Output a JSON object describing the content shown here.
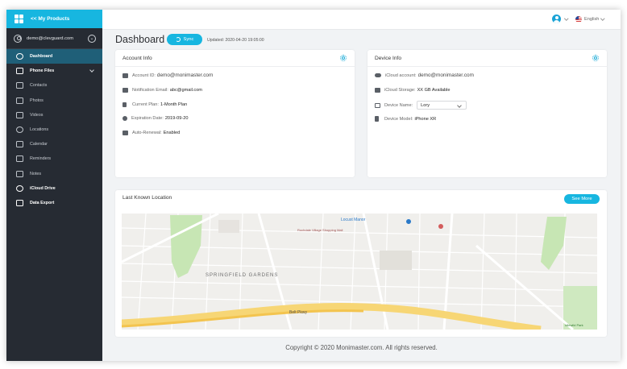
{
  "sidebar": {
    "back_label": "<< My Products",
    "account_email": "demo@clevguard.com",
    "items": [
      {
        "label": "Dashboard"
      },
      {
        "label": "Phone Files"
      },
      {
        "label": "Contacts"
      },
      {
        "label": "Photos"
      },
      {
        "label": "Videos"
      },
      {
        "label": "Locations"
      },
      {
        "label": "Calendar"
      },
      {
        "label": "Reminders"
      },
      {
        "label": "Notes"
      },
      {
        "label": "iCloud Drive"
      },
      {
        "label": "Data Export"
      }
    ]
  },
  "topbar": {
    "language": "English"
  },
  "header": {
    "title": "Dashboard",
    "sync_label": "Sync",
    "updated": "Updated: 2020-04-20 19:05:00"
  },
  "account_info": {
    "title": "Account Info",
    "rows": [
      {
        "key": "Account ID:",
        "value": "demo@monimaster.com"
      },
      {
        "key": "Notification Email:",
        "value": "abc@gmail.com"
      },
      {
        "key": "Current Plan:",
        "value": "1-Month Plan"
      },
      {
        "key": "Expiration Date:",
        "value": "2019-09-20"
      },
      {
        "key": "Auto-Renewal:",
        "value": "Enabled"
      }
    ]
  },
  "device_info": {
    "title": "Device Info",
    "icloud_key": "iCloud account:",
    "icloud_value": "demo@monimaster.com",
    "storage_key": "iCloud Storage:",
    "storage_value": "XX GB Available",
    "name_key": "Device Name:",
    "name_value": "Lory",
    "model_key": "Device Model:",
    "model_value": "iPhone XR"
  },
  "location": {
    "title": "Last Known Location",
    "see_more": "See More",
    "map_labels": {
      "area": "SPRINGFIELD GARDENS",
      "parkway": "Belt Pkwy",
      "locust": "Locust Manor",
      "mall": "Rochdale Village Shopping Mall",
      "park": "Idlewild Park"
    }
  },
  "footer": {
    "copyright": "Copyright © 2020 Monimaster.com. All rights reserved."
  },
  "colors": {
    "accent": "#17b6e0",
    "sidebar": "#262b33",
    "active": "#1f5f78"
  }
}
